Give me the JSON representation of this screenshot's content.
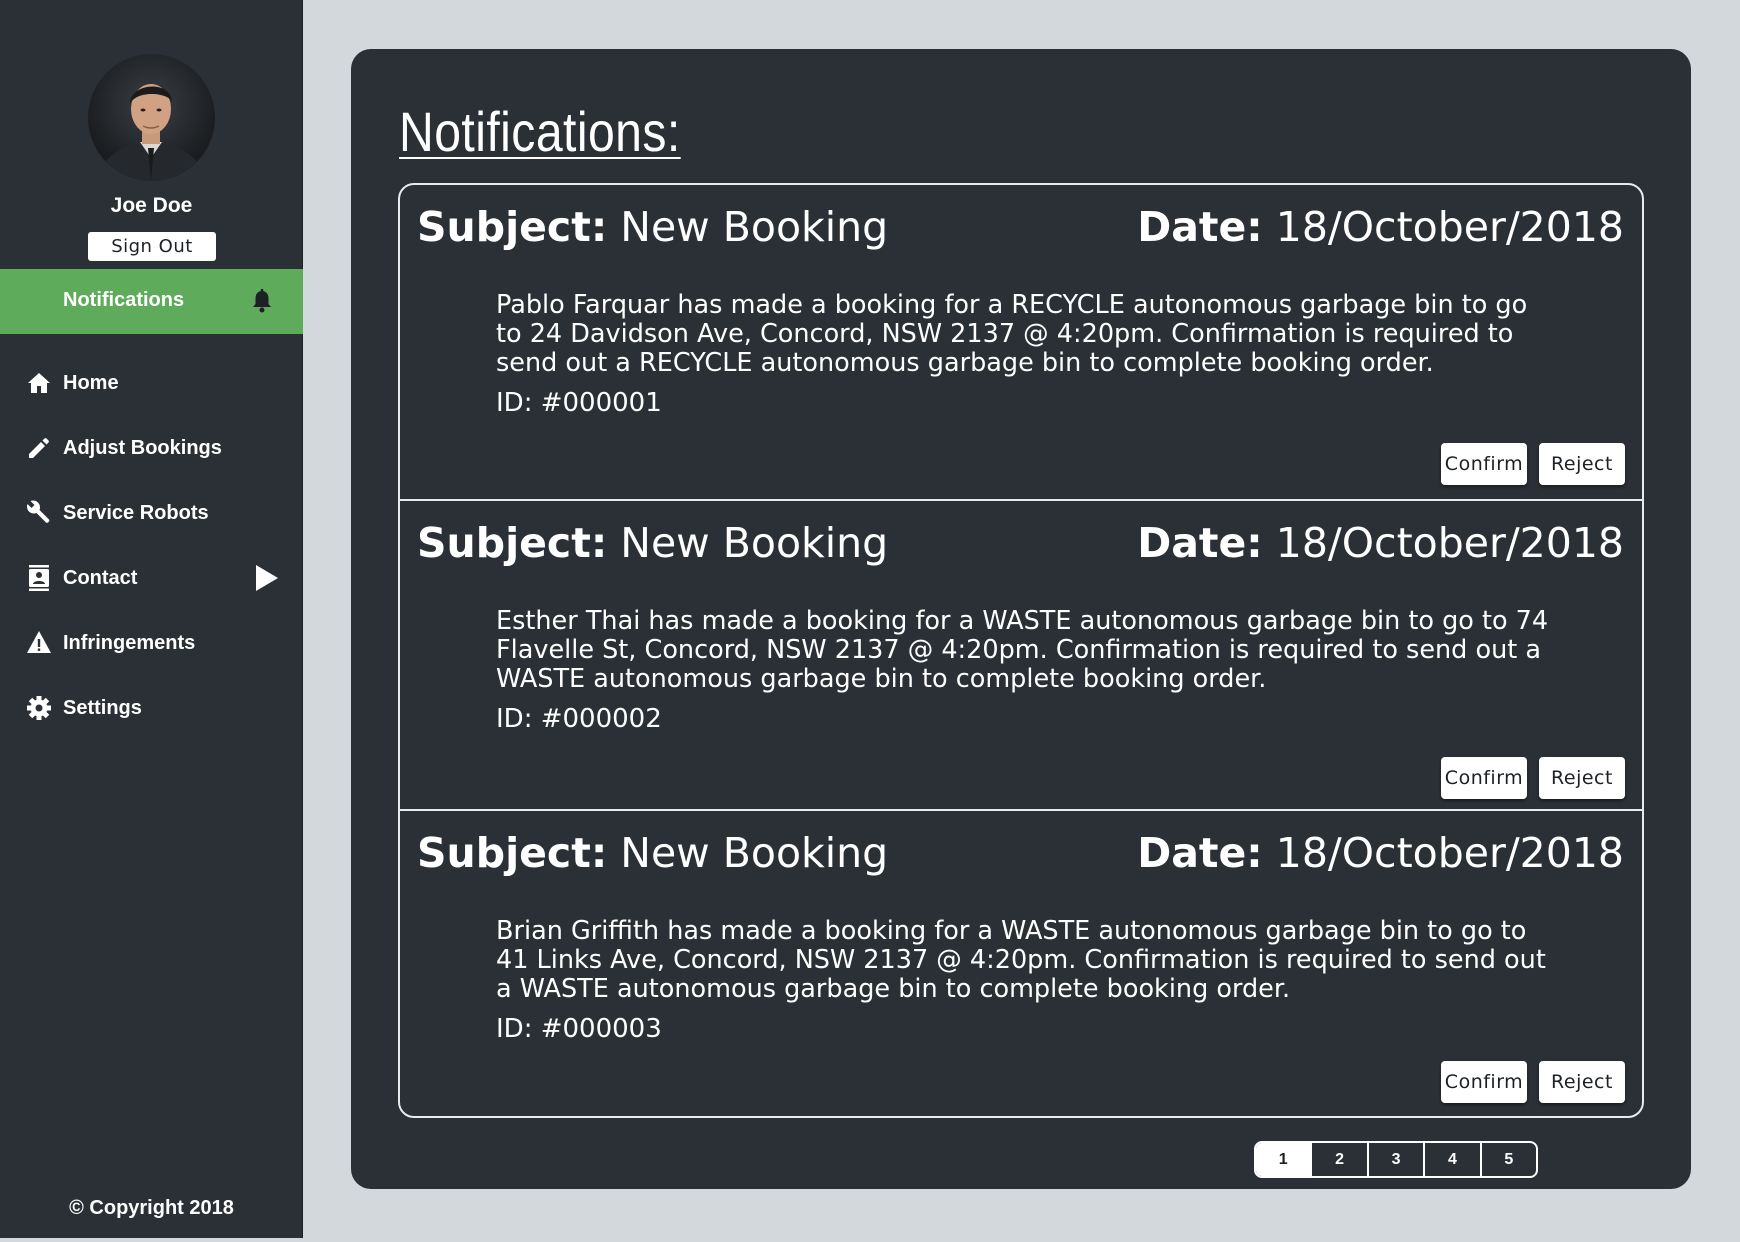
{
  "user": {
    "name": "Joe Doe",
    "sign_out_label": "Sign Out"
  },
  "sidebar": {
    "active": {
      "label": "Notifications",
      "icon": "bell-icon"
    },
    "items": [
      {
        "label": "Home",
        "icon": "home-icon"
      },
      {
        "label": "Adjust Bookings",
        "icon": "pencil-icon"
      },
      {
        "label": "Service Robots",
        "icon": "wrench-icon"
      },
      {
        "label": "Contact",
        "icon": "contact-book-icon",
        "has_submenu": true
      },
      {
        "label": "Infringements",
        "icon": "warning-icon"
      },
      {
        "label": "Settings",
        "icon": "gear-icon"
      }
    ],
    "copyright": "© Copyright 2018"
  },
  "main": {
    "title": "Notifications:",
    "notifications": [
      {
        "subject_label": "Subject:",
        "subject": "New Booking",
        "date_label": "Date:",
        "date": "18/October/2018",
        "message": "Pablo Farquar has made a booking for a RECYCLE autonomous garbage bin to go to 24 Davidson Ave, Concord, NSW 2137 @ 4:20pm. Confirmation is required to send out a RECYCLE autonomous garbage bin to complete booking order.",
        "id_text": "ID: #000001",
        "confirm_label": "Confirm",
        "reject_label": "Reject"
      },
      {
        "subject_label": "Subject:",
        "subject": "New Booking",
        "date_label": "Date:",
        "date": "18/October/2018",
        "message": "Esther Thai has made a booking for a WASTE autonomous garbage bin to go to 74 Flavelle St, Concord, NSW 2137 @ 4:20pm. Confirmation is required to send out a WASTE autonomous garbage bin to complete booking order.",
        "id_text": "ID: #000002",
        "confirm_label": "Confirm",
        "reject_label": "Reject"
      },
      {
        "subject_label": "Subject:",
        "subject": "New Booking",
        "date_label": "Date:",
        "date": "18/October/2018",
        "message": "Brian Griffith has made a booking for a WASTE autonomous garbage bin to go to 41 Links Ave, Concord, NSW 2137 @ 4:20pm. Confirmation is required to send out a WASTE autonomous garbage bin to complete booking order.",
        "id_text": "ID: #000003",
        "confirm_label": "Confirm",
        "reject_label": "Reject"
      }
    ],
    "pagination": {
      "pages": [
        "1",
        "2",
        "3",
        "4",
        "5"
      ],
      "current": "1"
    }
  },
  "colors": {
    "background": "#d3d8dc",
    "panel": "#2a3035",
    "accent_green": "#5fab5c",
    "text": "#ffffff"
  }
}
